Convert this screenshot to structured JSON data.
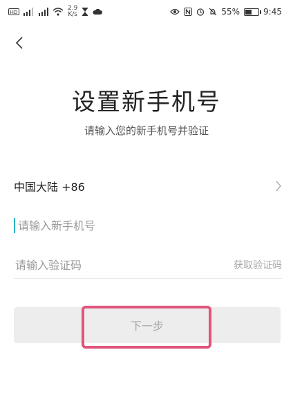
{
  "status_bar": {
    "net_speed_value": "2.9",
    "net_speed_unit": "K/s",
    "battery": "55%",
    "battery_level": 0.55,
    "time": "9:45"
  },
  "header": {
    "back_icon": "chevron-left-icon"
  },
  "page": {
    "title": "设置新手机号",
    "subtitle": "请输入您的新手机号并验证"
  },
  "form": {
    "region_label": "中国大陆 +86",
    "phone_placeholder": "请输入新手机号",
    "code_placeholder": "请输入验证码",
    "get_code_label": "获取验证码"
  },
  "actions": {
    "next_label": "下一步"
  },
  "colors": {
    "highlight": "#e0557a",
    "cursor": "#2ab3c7",
    "button_bg": "#ededed"
  }
}
